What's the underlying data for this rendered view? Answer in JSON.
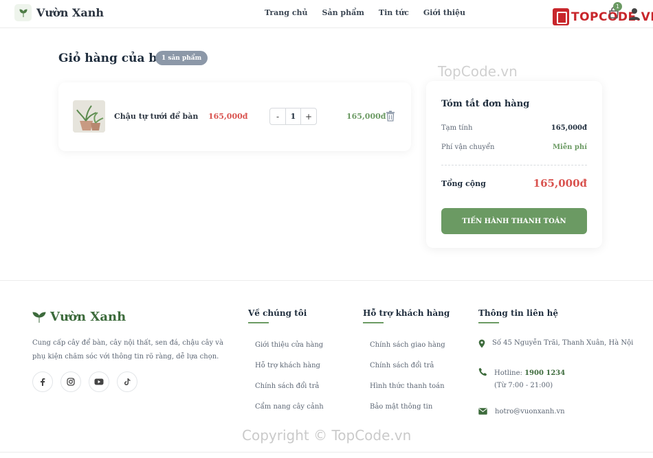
{
  "header": {
    "brand": "Vườn Xanh",
    "nav": [
      "Trang chủ",
      "Sản phẩm",
      "Tin tức",
      "Giới thiệu"
    ],
    "cart_count": "1",
    "badge_text": "TOPCODE.VN"
  },
  "cart": {
    "title": "Giỏ hàng của bạn",
    "count_badge": "1 sản phẩm",
    "items": [
      {
        "name": "Chậu tự tưới để bàn",
        "price": "165,000đ",
        "quantity": "1",
        "total": "165,000đ",
        "minus": "-",
        "plus": "+"
      }
    ]
  },
  "summary": {
    "title": "Tóm tắt đơn hàng",
    "subtotal_label": "Tạm tính",
    "subtotal_value": "165,000đ",
    "shipping_label": "Phí vận chuyển",
    "shipping_value": "Miễn phí",
    "total_label": "Tổng cộng",
    "total_value": "165,000đ",
    "checkout_label": "TIẾN HÀNH THANH TOÁN"
  },
  "watermarks": {
    "top": "TopCode.vn",
    "bottom": "Copyright © TopCode.vn"
  },
  "footer": {
    "brand": "Vườn Xanh",
    "description": "Cung cấp cây để bàn, cây nội thất, sen đá, chậu cây và phụ kiện chăm sóc với thông tin rõ ràng, dễ lựa chọn.",
    "about": {
      "title": "Về chúng tôi",
      "links": [
        "Giới thiệu cửa hàng",
        "Hỗ trợ khách hàng",
        "Chính sách đổi trả",
        "Cẩm nang cây cảnh"
      ]
    },
    "support": {
      "title": "Hỗ trợ khách hàng",
      "links": [
        "Chính sách giao hàng",
        "Chính sách đổi trả",
        "Hình thức thanh toán",
        "Bảo mật thông tin"
      ]
    },
    "contact": {
      "title": "Thông tin liên hệ",
      "address": "Số 45 Nguyễn Trãi, Thanh Xuân, Hà Nội",
      "hotline_label": "Hotline:",
      "hotline_number": "1900 1234",
      "hours": "(Từ 7:00 - 21:00)",
      "email": "hotro@vuonxanh.vn"
    }
  },
  "colors": {
    "accent_green": "#6b9a63",
    "price_red": "#d9534f",
    "brand_red": "#c8262b"
  }
}
